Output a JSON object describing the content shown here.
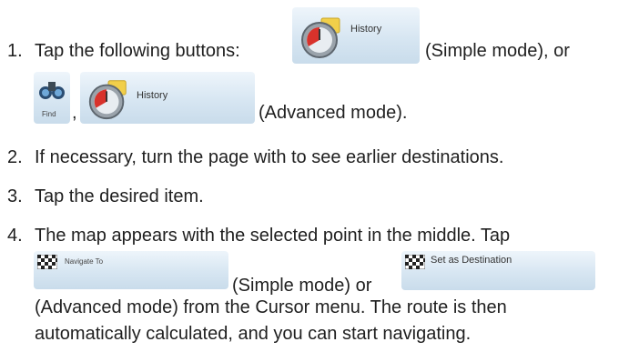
{
  "steps": [
    {
      "number": "1.",
      "lines": [
        "Tap the following buttons:",
        "(Simple mode), or",
        ",",
        "(Advanced mode)."
      ]
    },
    {
      "number": "2.",
      "lines": [
        "If necessary, turn the page with   to see earlier destinations."
      ]
    },
    {
      "number": "3.",
      "lines": [
        "Tap the desired item."
      ]
    },
    {
      "number": "4.",
      "lines": [
        "The map appears with the selected point in the middle. Tap",
        "(Simple mode) or",
        "(Advanced mode) from the Cursor menu. The route is then",
        "automatically calculated, and you can start navigating."
      ]
    }
  ],
  "buttons": {
    "history_label": "History",
    "find_label": "Find",
    "navigate_to_label": "Navigate To",
    "set_as_destination_label": "Set as Destination"
  },
  "icons": {
    "history": "clock-folder-icon",
    "find": "binoculars-icon",
    "navigate": "checkered-flag-icon"
  }
}
